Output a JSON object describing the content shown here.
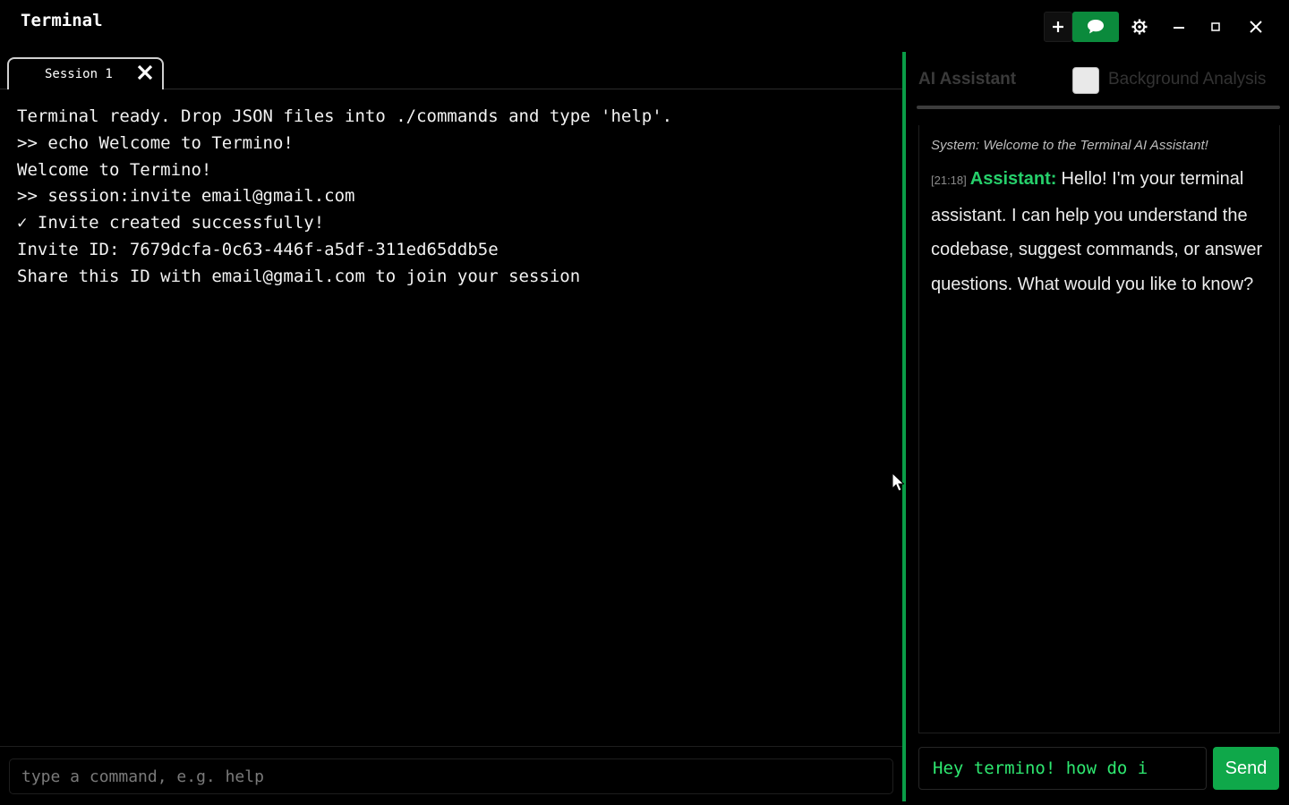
{
  "app": {
    "title": "Terminal"
  },
  "toolbar": {
    "new_tab_icon": "plus-icon",
    "chat_icon": "chat-bubble-icon",
    "settings_icon": "gear-icon",
    "minimize_icon": "minimize-icon",
    "maximize_icon": "maximize-icon",
    "close_icon": "close-icon"
  },
  "tabs": [
    {
      "label": "Session 1",
      "active": true
    }
  ],
  "terminal": {
    "lines": [
      "Terminal ready. Drop JSON files into ./commands and type 'help'.",
      ">> echo Welcome to Termino!",
      "Welcome to Termino!",
      ">> session:invite email@gmail.com",
      "✓ Invite created successfully!",
      "Invite ID: 7679dcfa-0c63-446f-a5df-311ed65ddb5e",
      "Share this ID with email@gmail.com to join your session"
    ],
    "input_placeholder": "type a command, e.g. help",
    "input_value": ""
  },
  "ai_panel": {
    "tab_ai": "AI Assistant",
    "tab_background": "Background Analysis",
    "background_checked": false,
    "system_message": "System: Welcome to the Terminal AI Assistant!",
    "messages": [
      {
        "time": "[21:18]",
        "author": "Assistant:",
        "text": "Hello! I'm your terminal assistant. I can help you understand the codebase, suggest commands, or answer questions. What would you like to know?"
      }
    ],
    "input_value": "Hey termino! how do i",
    "send_label": "Send"
  },
  "colors": {
    "accent": "#0a9c47",
    "send": "#0fa84a",
    "chat_button": "#0b8a3c",
    "assistant_name": "#26d06b",
    "chat_input_text": "#2ee870"
  }
}
